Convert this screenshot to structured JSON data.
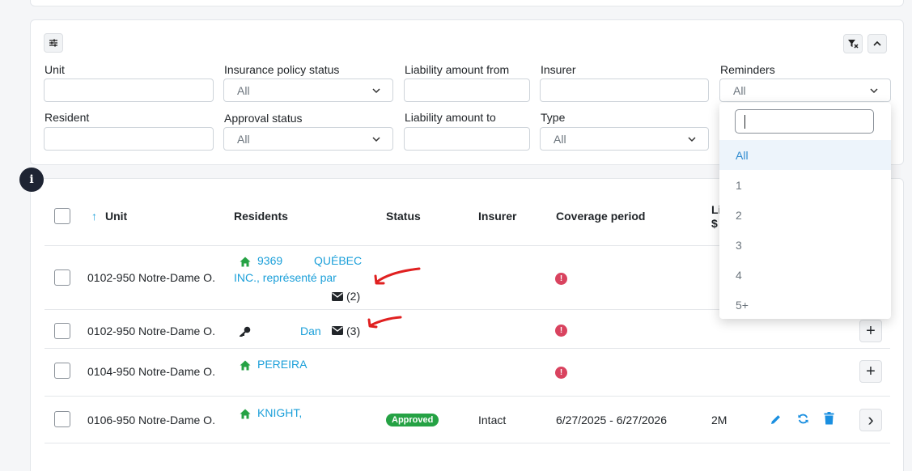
{
  "filters": {
    "unit_label": "Unit",
    "insurance_status_label": "Insurance policy status",
    "insurance_status_value": "All",
    "liability_from_label": "Liability amount from",
    "insurer_label": "Insurer",
    "reminders_label": "Reminders",
    "reminders_value": "All",
    "resident_label": "Resident",
    "approval_status_label": "Approval status",
    "approval_status_value": "All",
    "liability_to_label": "Liability amount to",
    "type_label": "Type",
    "type_value": "All"
  },
  "dropdown": {
    "search_value": "",
    "options": [
      "All",
      "1",
      "2",
      "3",
      "4",
      "5+"
    ],
    "selected": "All"
  },
  "info_badge": "i",
  "table": {
    "headers": {
      "unit": "Unit",
      "sort_arrow": "↑",
      "residents": "Residents",
      "status": "Status",
      "insurer": "Insurer",
      "coverage": "Coverage period",
      "liability_top": "Li",
      "liability_bottom": "$"
    },
    "rows": [
      {
        "unit": "0102-950 Notre-Dame O.",
        "resident_line1_a": "9369",
        "resident_line1_b": "QUÉBEC",
        "resident_line2": "INC., représenté par",
        "mail_count": "(2)",
        "warning": "!"
      },
      {
        "unit": "0102-950 Notre-Dame O.",
        "resident": "Dan",
        "mail_count": "(3)",
        "warning": "!",
        "action": "+"
      },
      {
        "unit": "0104-950 Notre-Dame O.",
        "resident": "PEREIRA",
        "warning": "!",
        "action": "+"
      },
      {
        "unit": "0106-950 Notre-Dame O.",
        "resident": "KNIGHT,",
        "status": "Approved",
        "insurer": "Intact",
        "coverage": "6/27/2025 - 6/27/2026",
        "liability": "2M",
        "action": "›"
      }
    ]
  },
  "colors": {
    "link": "#1a9fd9",
    "home_icon": "#25a244",
    "approved": "#25a244",
    "warning": "#d9435f",
    "annotation_arrow": "#e02020",
    "action_icon": "#1a8fe0"
  }
}
